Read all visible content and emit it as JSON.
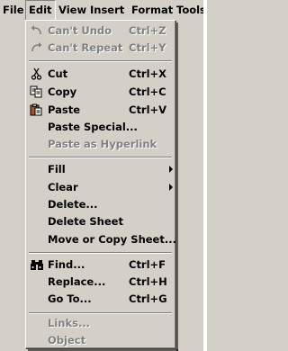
{
  "menubar": {
    "items": [
      {
        "label": "File"
      },
      {
        "label": "Edit"
      },
      {
        "label": "View"
      },
      {
        "label": "Insert"
      },
      {
        "label": "Format"
      },
      {
        "label": "Tools"
      }
    ]
  },
  "edit_menu": {
    "items": [
      {
        "label": "Can't Undo",
        "shortcut": "Ctrl+Z",
        "icon": "undo-icon",
        "enabled": false
      },
      {
        "label": "Can't Repeat",
        "shortcut": "Ctrl+Y",
        "icon": "repeat-icon",
        "enabled": false
      },
      {
        "label": "Cut",
        "shortcut": "Ctrl+X",
        "icon": "scissors-icon",
        "enabled": true
      },
      {
        "label": "Copy",
        "shortcut": "Ctrl+C",
        "icon": "copy-icon",
        "enabled": true
      },
      {
        "label": "Paste",
        "shortcut": "Ctrl+V",
        "icon": "paste-icon",
        "enabled": true
      },
      {
        "label": "Paste Special...",
        "enabled": true
      },
      {
        "label": "Paste as Hyperlink",
        "enabled": false
      },
      {
        "label": "Fill",
        "submenu": true,
        "enabled": true
      },
      {
        "label": "Clear",
        "submenu": true,
        "enabled": true
      },
      {
        "label": "Delete...",
        "enabled": true
      },
      {
        "label": "Delete Sheet",
        "enabled": true
      },
      {
        "label": "Move or Copy Sheet...",
        "enabled": true
      },
      {
        "label": "Find...",
        "shortcut": "Ctrl+F",
        "icon": "binoculars-icon",
        "enabled": true
      },
      {
        "label": "Replace...",
        "shortcut": "Ctrl+H",
        "enabled": true
      },
      {
        "label": "Go To...",
        "shortcut": "Ctrl+G",
        "enabled": true
      },
      {
        "label": "Links...",
        "enabled": false
      },
      {
        "label": "Object",
        "enabled": false
      }
    ]
  }
}
